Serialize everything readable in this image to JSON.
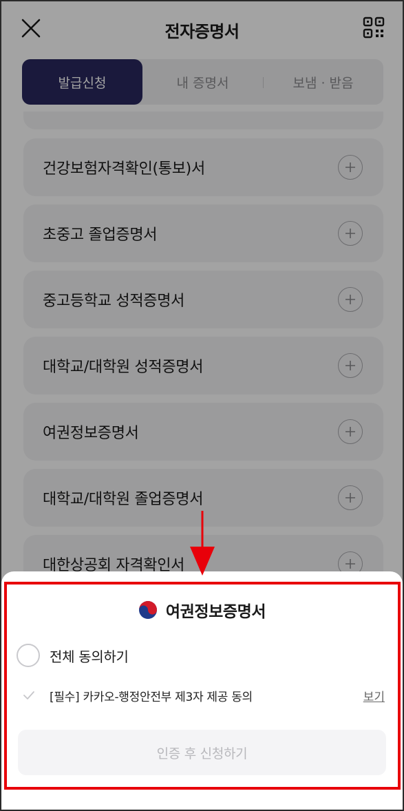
{
  "header": {
    "title": "전자증명서",
    "close_icon": "close-icon",
    "qr_icon": "qr-code-icon"
  },
  "tabs": [
    {
      "label": "발급신청",
      "active": true
    },
    {
      "label": "내 증명서",
      "active": false
    },
    {
      "label": "보냄 · 받음",
      "active": false
    }
  ],
  "certificates": [
    {
      "label": "건강보험자격확인(통보)서"
    },
    {
      "label": "초중고 졸업증명서"
    },
    {
      "label": "중고등학교 성적증명서"
    },
    {
      "label": "대학교/대학원 성적증명서"
    },
    {
      "label": "여권정보증명서"
    },
    {
      "label": "대학교/대학원 졸업증명서"
    },
    {
      "label": "대한상공회 자격확인서"
    }
  ],
  "sheet": {
    "title": "여권정보증명서",
    "agree_all_label": "전체 동의하기",
    "agree_item_label": "[필수] 카카오-행정안전부 제3자 제공 동의",
    "view_label": "보기",
    "submit_label": "인증 후 신청하기"
  },
  "colors": {
    "tab_active_bg": "#29285f",
    "highlight_border": "#e8000a",
    "arrow": "#e8000a"
  }
}
